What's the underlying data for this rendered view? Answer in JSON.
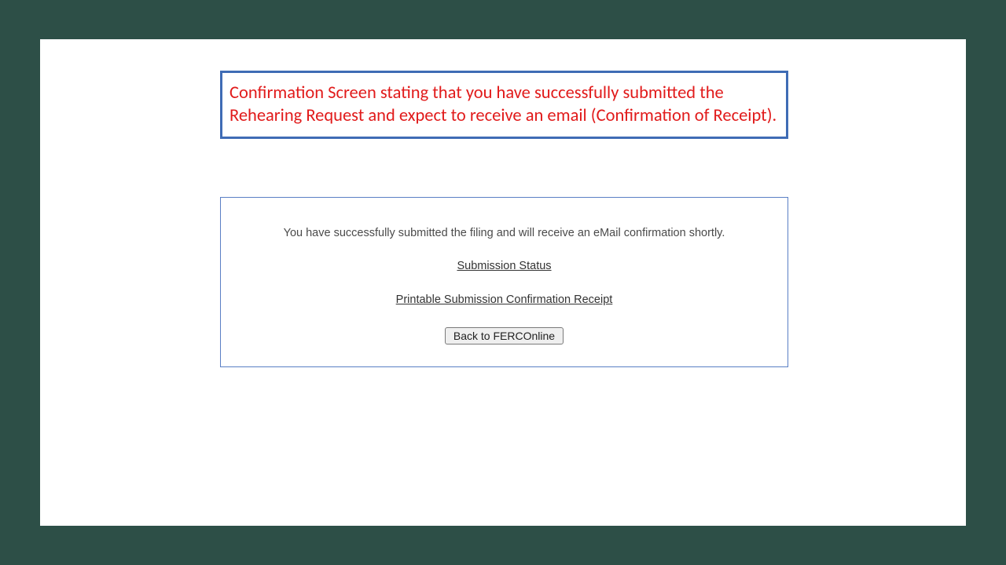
{
  "annotation": {
    "text": "Confirmation Screen stating that you have successfully submitted the Rehearing Request and expect to receive an email (Confirmation of Receipt)."
  },
  "confirmation": {
    "message": "You have successfully submitted the filing and will receive an eMail confirmation shortly.",
    "link_status": "Submission Status",
    "link_receipt": "Printable Submission Confirmation Receipt",
    "back_button": "Back to FERCOnline"
  }
}
